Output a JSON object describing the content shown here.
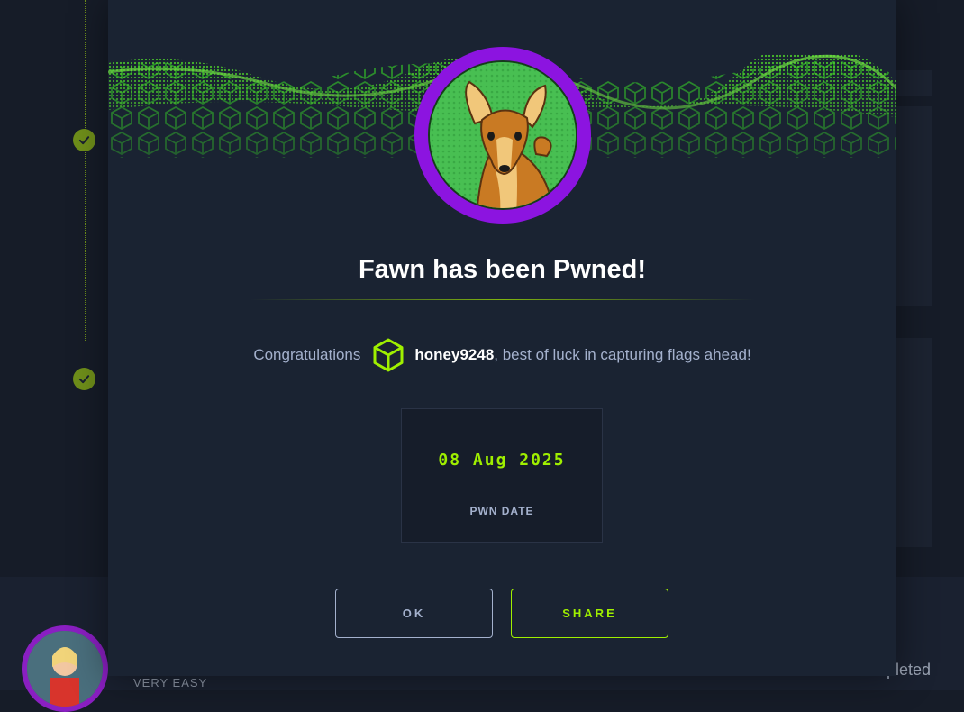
{
  "background": {
    "difficulty": "VERY EASY",
    "completed_text": "pleted"
  },
  "modal": {
    "title": "Fawn has been Pwned!",
    "congrats_prefix": "Congratulations",
    "username": "honey9248",
    "congrats_suffix": ", best of luck in capturing flags ahead!",
    "pwn_date_value": "08 Aug 2025",
    "pwn_date_label": "PWN DATE",
    "ok_label": "OK",
    "share_label": "SHARE"
  },
  "icons": {
    "check": "check-icon",
    "user_badge": "cube-icon",
    "machine_avatar": "fawn-deer-avatar"
  },
  "colors": {
    "accent_green": "#9fef00",
    "avatar_ring": "#8c14e0",
    "modal_bg": "#1a2332",
    "text_muted": "#a4b1cd"
  }
}
